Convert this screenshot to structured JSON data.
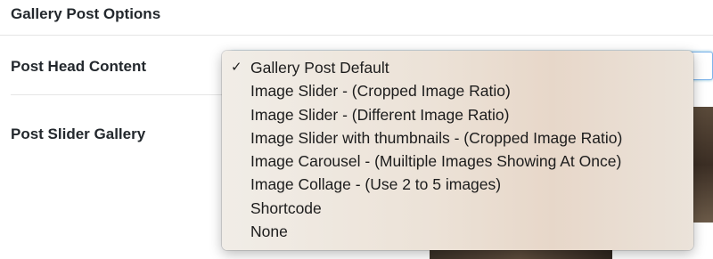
{
  "panel": {
    "title": "Gallery Post Options"
  },
  "fields": {
    "post_head_content_label": "Post Head Content",
    "post_slider_gallery_label": "Post Slider Gallery"
  },
  "dropdown": {
    "selected_index": 0,
    "checkmark": "✓",
    "options": [
      "Gallery Post Default",
      "Image Slider - (Cropped Image Ratio)",
      "Image Slider - (Different Image Ratio)",
      "Image Slider with thumbnails - (Cropped Image Ratio)",
      "Image Carousel - (Muiltiple Images Showing At Once)",
      "Image Collage - (Use 2 to 5 images)",
      "Shortcode",
      "None"
    ]
  }
}
